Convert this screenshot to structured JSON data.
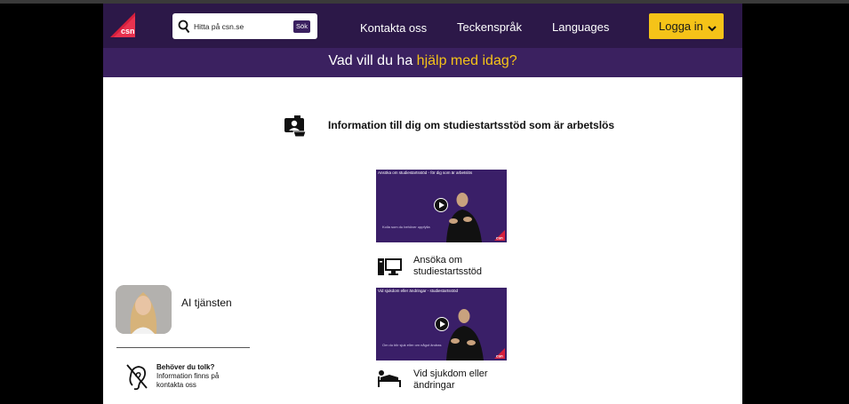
{
  "header": {
    "logo_text": "csn",
    "search": {
      "placeholder": "Hitta på csn.se",
      "button_label": "Sök"
    },
    "nav": [
      {
        "label": "Kontakta oss"
      },
      {
        "label": "Teckenspråk"
      },
      {
        "label": "Languages"
      }
    ],
    "login_label": "Logga in"
  },
  "help_bar": {
    "prefix": "Vad vill du ha ",
    "highlight": "hjälp med idag?"
  },
  "main": {
    "heading": "Information till dig om studiestartsstöd som är arbetslös",
    "videos": [
      {
        "title": "Ansöka om studiestartsstöd - för dig som är arbetslös",
        "subtext": "Kolla som du behöver uppfylla",
        "logo_text": "csn"
      },
      {
        "title": "Vid sjukdom eller ändringar - studiestartsstöd",
        "subtext": "Om du blir sjuk eller om något ändras",
        "logo_text": "csn"
      }
    ],
    "items": [
      {
        "label": "Ansöka om studiestartsstöd",
        "icon": "computer-icon"
      },
      {
        "label": "Vid sjukdom eller ändringar",
        "icon": "sickbed-icon"
      }
    ]
  },
  "sidebar": {
    "ai_label": "AI tjänsten",
    "tolk_title": "Behöver du tolk?",
    "tolk_text": "Information finns på kontakta oss"
  },
  "colors": {
    "header_bg": "#2c1848",
    "help_bar_bg": "#3b2160",
    "accent_yellow": "#f5c318",
    "brand_red": "#d61f3c"
  }
}
